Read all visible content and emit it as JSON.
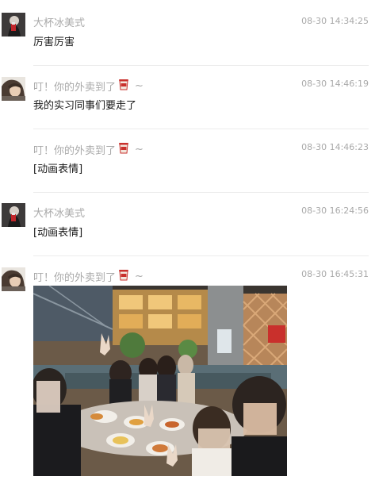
{
  "messages": [
    {
      "sender": "大杯冰美式",
      "time": "08-30 14:34:25",
      "text": "厉害厉害"
    },
    {
      "sender": "叮！你的外卖到了",
      "time": "08-30 14:46:19",
      "text": "我的实习同事们要走了"
    },
    {
      "sender": "叮！你的外卖到了",
      "time": "08-30 14:46:23",
      "text": "[动画表情]"
    },
    {
      "sender": "大杯冰美式",
      "time": "08-30 16:24:56",
      "text": "[动画表情]"
    },
    {
      "sender": "叮！你的外卖到了",
      "time": "08-30 16:45:31",
      "text": ""
    }
  ],
  "suffix": "~",
  "icons": {
    "avatar_a": "avatar-dark-figure",
    "avatar_b": "avatar-person-photo",
    "sender_emoji": "takeout-cup-emoji"
  },
  "colors": {
    "meta_text": "#a9a9a9",
    "body_text": "#1a1a1a",
    "divider": "#ececec"
  }
}
